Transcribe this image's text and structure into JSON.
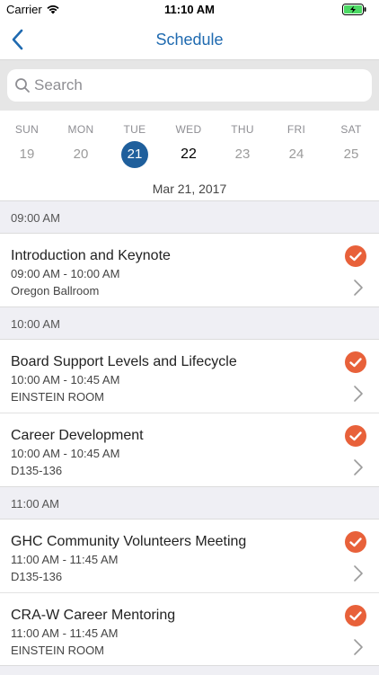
{
  "status_bar": {
    "carrier": "Carrier",
    "time": "11:10 AM"
  },
  "nav": {
    "title": "Schedule"
  },
  "search": {
    "placeholder": "Search"
  },
  "days": [
    {
      "name": "SUN",
      "num": "19"
    },
    {
      "name": "MON",
      "num": "20"
    },
    {
      "name": "TUE",
      "num": "21"
    },
    {
      "name": "WED",
      "num": "22"
    },
    {
      "name": "THU",
      "num": "23"
    },
    {
      "name": "FRI",
      "num": "24"
    },
    {
      "name": "SAT",
      "num": "25"
    }
  ],
  "selected_date": "Mar 21, 2017",
  "colors": {
    "accent": "#1f6ab0",
    "selected_day": "#1f5f9c",
    "check": "#e8613a",
    "section_bg": "#efeff4"
  },
  "sections": [
    {
      "header": "09:00 AM",
      "sessions": [
        {
          "title": "Introduction and Keynote",
          "time": "09:00 AM - 10:00 AM",
          "room": "Oregon Ballroom"
        }
      ]
    },
    {
      "header": "10:00 AM",
      "sessions": [
        {
          "title": "Board Support Levels and Lifecycle",
          "time": "10:00 AM - 10:45 AM",
          "room": "EINSTEIN ROOM"
        },
        {
          "title": "Career Development",
          "time": "10:00 AM - 10:45 AM",
          "room": "D135-136"
        }
      ]
    },
    {
      "header": "11:00 AM",
      "sessions": [
        {
          "title": "GHC Community Volunteers Meeting",
          "time": "11:00 AM - 11:45 AM",
          "room": "D135-136"
        },
        {
          "title": "CRA-W Career Mentoring",
          "time": "11:00 AM - 11:45 AM",
          "room": "EINSTEIN ROOM"
        }
      ]
    }
  ]
}
